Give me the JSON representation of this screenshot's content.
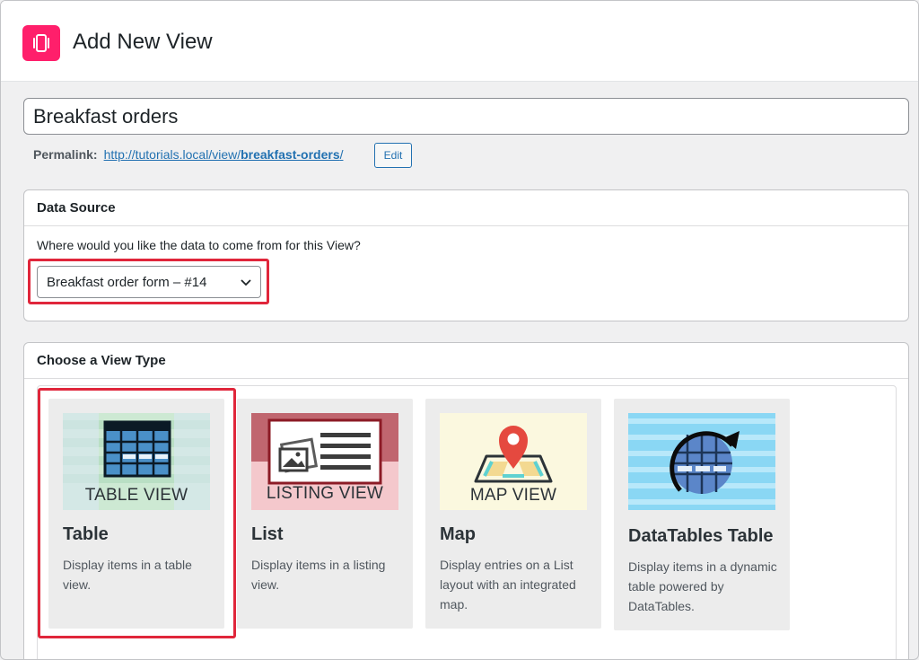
{
  "header": {
    "title": "Add New View",
    "logo_icon": "gravityview-logo-icon",
    "brand_color": "#ff1f6b"
  },
  "title_field": {
    "value": "Breakfast orders"
  },
  "permalink": {
    "label": "Permalink:",
    "url_prefix": "http://tutorials.local/view/",
    "slug": "breakfast-orders",
    "url_suffix": "/",
    "edit_label": "Edit"
  },
  "data_source": {
    "heading": "Data Source",
    "question": "Where would you like the data to come from for this View?",
    "selected": "Breakfast order form – #14"
  },
  "view_types": {
    "heading": "Choose a View Type",
    "items": [
      {
        "name": "Table",
        "thumb_label": "TABLE VIEW",
        "description": "Display items in a table view.",
        "icon": "table-icon"
      },
      {
        "name": "List",
        "thumb_label": "LISTING VIEW",
        "description": "Display items in a listing view.",
        "icon": "listing-icon"
      },
      {
        "name": "Map",
        "thumb_label": "MAP VIEW",
        "description": "Display entries on a List layout with an integrated map.",
        "icon": "map-pin-icon"
      },
      {
        "name": "DataTables Table",
        "thumb_label": "",
        "description": "Display items in a dynamic table powered by DataTables.",
        "icon": "datatables-icon"
      }
    ]
  },
  "colors": {
    "highlight": "#e0263b",
    "link": "#2271b1"
  }
}
